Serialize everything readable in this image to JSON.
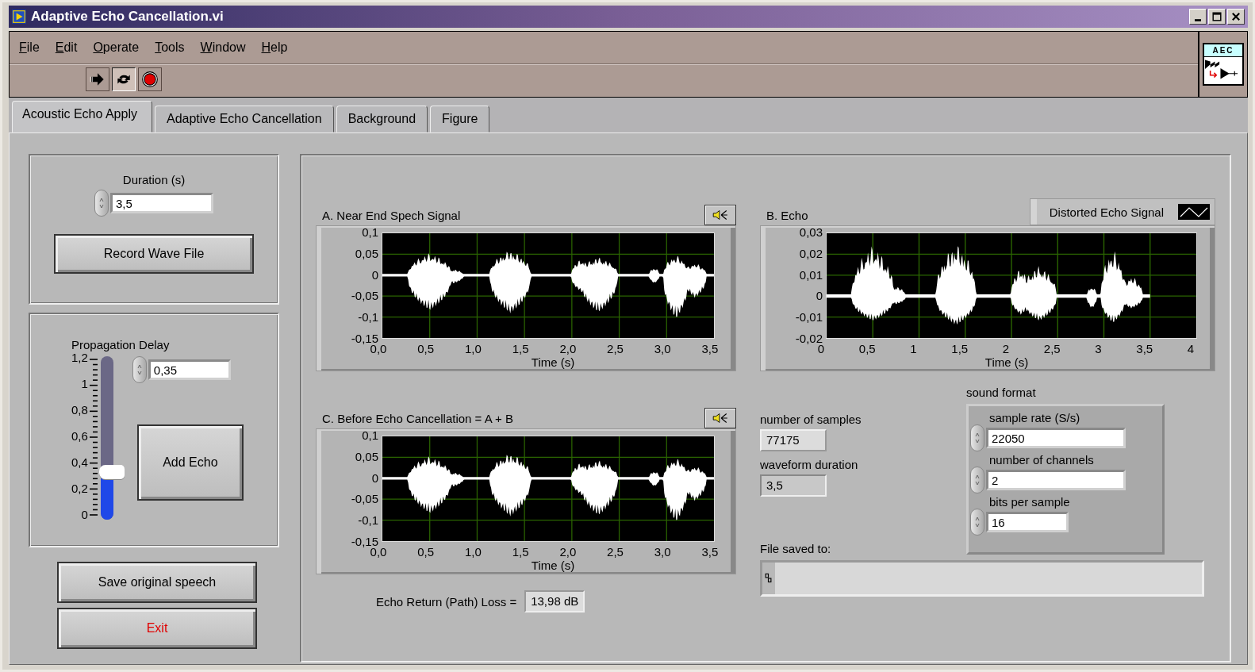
{
  "window": {
    "title": "Adaptive Echo Cancellation.vi"
  },
  "menu": [
    "File",
    "Edit",
    "Operate",
    "Tools",
    "Window",
    "Help"
  ],
  "vi_icon": {
    "label": "AEC"
  },
  "tabs": [
    {
      "label": "Acoustic Echo Apply",
      "selected": true
    },
    {
      "label": "Adaptive Echo Cancellation",
      "selected": false
    },
    {
      "label": "Background",
      "selected": false
    },
    {
      "label": "Figure",
      "selected": false
    }
  ],
  "duration": {
    "label": "Duration (s)",
    "value": "3,5"
  },
  "record_button": "Record Wave File",
  "propagation_delay": {
    "label": "Propagation Delay",
    "scale": [
      "1,2",
      "1",
      "0,8",
      "0,6",
      "0,4",
      "0,2",
      "0"
    ],
    "level": 0.29,
    "value": "0,35"
  },
  "add_echo_button": "Add Echo",
  "save_button": "Save original speech",
  "exit_button": "Exit",
  "graphs": [
    {
      "kind": "speech",
      "title": "A. Near End Spech Signal",
      "speaker": true,
      "y_ticks": [
        "0,1",
        "0,05",
        "0",
        "-0,05",
        "-0,1",
        "-0,15"
      ],
      "x_ticks": [
        "0,0",
        "0,5",
        "1,0",
        "1,5",
        "2,0",
        "2,5",
        "3,0",
        "3,5"
      ],
      "x_label": "Time (s)"
    },
    {
      "kind": "echo",
      "title": "B. Echo",
      "speaker": false,
      "legend": "Distorted Echo Signal",
      "y_ticks": [
        "0,03",
        "0,02",
        "0,01",
        "0",
        "-0,01",
        "-0,02"
      ],
      "x_ticks": [
        "0",
        "0,5",
        "1",
        "1,5",
        "2",
        "2,5",
        "3",
        "3,5",
        "4"
      ],
      "x_label": "Time (s)"
    },
    {
      "kind": "speech",
      "title": "C. Before Echo Cancellation = A + B",
      "speaker": true,
      "y_ticks": [
        "0,1",
        "0,05",
        "0",
        "-0,05",
        "-0,1",
        "-0,15"
      ],
      "x_ticks": [
        "0,0",
        "0,5",
        "1,0",
        "1,5",
        "2,0",
        "2,5",
        "3,0",
        "3,5"
      ],
      "x_label": "Time (s)"
    }
  ],
  "erl": {
    "label": "Echo Return (Path) Loss =",
    "value": "13,98 dB"
  },
  "number_of_samples": {
    "label": "number of samples",
    "value": "77175"
  },
  "waveform_duration": {
    "label": "waveform duration",
    "value": "3,5"
  },
  "sound_format": {
    "label": "sound format",
    "fields": [
      {
        "label": "sample rate (S/s)",
        "value": "22050"
      },
      {
        "label": "number of channels",
        "value": "2"
      },
      {
        "label": "bits per sample",
        "value": "16"
      }
    ]
  },
  "file_saved": {
    "label": "File saved to:"
  }
}
